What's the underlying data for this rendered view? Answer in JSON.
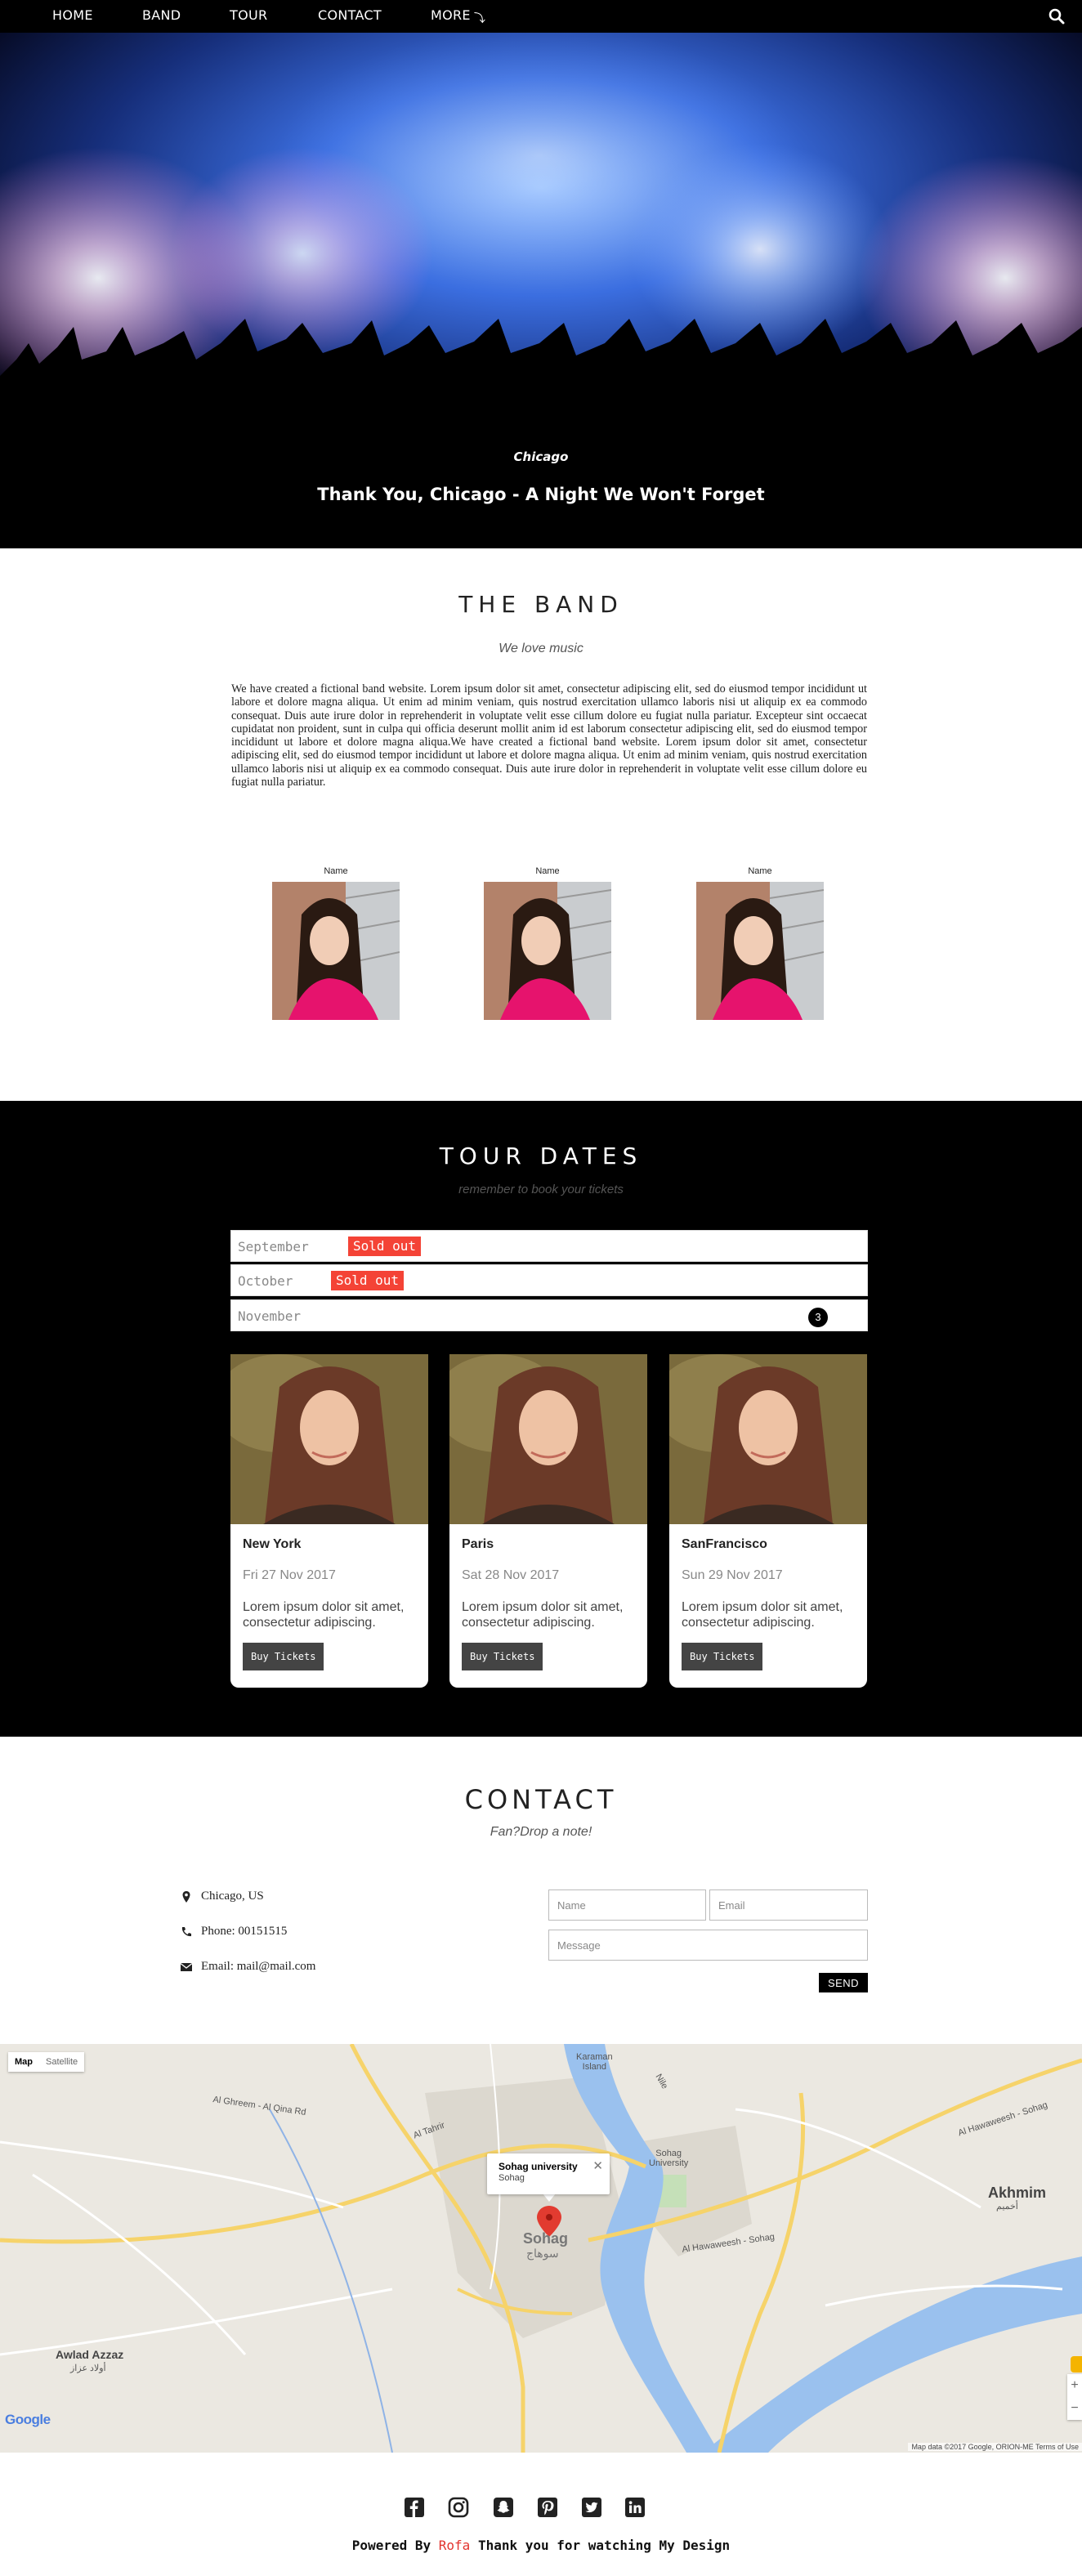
{
  "nav": {
    "items": [
      {
        "label": "HOME"
      },
      {
        "label": "BAND"
      },
      {
        "label": "TOUR"
      },
      {
        "label": "CONTACT"
      },
      {
        "label": "MORE"
      }
    ],
    "search_icon": "search-icon"
  },
  "hero": {
    "city": "Chicago",
    "caption": "Thank You, Chicago - A Night We Won't Forget"
  },
  "band": {
    "title": "THE BAND",
    "subtitle": "We love music",
    "text": "We have created a fictional band website. Lorem ipsum dolor sit amet, consectetur adipiscing elit, sed do eiusmod tempor incididunt ut labore et dolore magna aliqua. Ut enim ad minim veniam, quis nostrud exercitation ullamco laboris nisi ut aliquip ex ea commodo consequat. Duis aute irure dolor in reprehenderit in voluptate velit esse cillum dolore eu fugiat nulla pariatur. Excepteur sint occaecat cupidatat non proident, sunt in culpa qui officia deserunt mollit anim id est laborum consectetur adipiscing elit, sed do eiusmod tempor incididunt ut labore et dolore magna aliqua.We have created a fictional band website. Lorem ipsum dolor sit amet, consectetur adipiscing elit, sed do eiusmod tempor incididunt ut labore et dolore magna aliqua. Ut enim ad minim veniam, quis nostrud exercitation ullamco laboris nisi ut aliquip ex ea commodo consequat. Duis aute irure dolor in reprehenderit in voluptate velit esse cillum dolore eu fugiat nulla pariatur.",
    "members": [
      {
        "name": "Name"
      },
      {
        "name": "Name"
      },
      {
        "name": "Name"
      }
    ]
  },
  "tour": {
    "title": "TOUR DATES",
    "subtitle": "remember to book your tickets",
    "months": [
      {
        "name": "September",
        "badge": "Sold out"
      },
      {
        "name": "October",
        "badge": "Sold out"
      },
      {
        "name": "November",
        "count": "3"
      }
    ],
    "cities": [
      {
        "name": "New York",
        "date": "Fri 27 Nov 2017",
        "desc": "Lorem ipsum dolor sit amet, consectetur adipiscing.",
        "button": "Buy Tickets"
      },
      {
        "name": "Paris",
        "date": "Sat 28 Nov 2017",
        "desc": "Lorem ipsum dolor sit amet, consectetur adipiscing.",
        "button": "Buy Tickets"
      },
      {
        "name": "SanFrancisco",
        "date": "Sun 29 Nov 2017",
        "desc": "Lorem ipsum dolor sit amet, consectetur adipiscing.",
        "button": "Buy Tickets"
      }
    ]
  },
  "contact": {
    "title": "CONTACT",
    "subtitle": "Fan?Drop a note!",
    "location": "Chicago, US",
    "phone": "Phone: 00151515",
    "email": "Email: mail@mail.com",
    "name_placeholder": "Name",
    "email_placeholder": "Email",
    "message_placeholder": "Message",
    "send": "SEND"
  },
  "map": {
    "type_map": "Map",
    "type_satellite": "Satellite",
    "info_title": "Sohag university",
    "info_sub": "Sohag",
    "city_label": "Sohag",
    "city_label_ar": "سوهاج",
    "labels": {
      "karaman": "Karaman\nIsland",
      "akhmim": "Akhmim",
      "akhmim_ar": "أخميم",
      "awlad_azzaz": "Awlad Azzaz",
      "awlad_azzaz_ar": "أولاد عزاز",
      "sohag_univ": "Sohag\nUniversity",
      "al_hawaweesh": "Al Hawaweesh - Sohag",
      "al_hawaweesh2": "Al Hawaweesh - Sohag",
      "al_gheleem": "Al Ghreem - Al Qina Rd",
      "nile": "Nile",
      "al_tahrir": "Al Tahrir"
    },
    "google": "Google",
    "attribution": "Map data ©2017 Google, ORION-ME    Terms of Use",
    "zoom_in": "+",
    "zoom_out": "−"
  },
  "footer": {
    "social": [
      "facebook-icon",
      "instagram-icon",
      "snapchat-icon",
      "pinterest-icon",
      "twitter-icon",
      "linkedin-icon"
    ],
    "powered_prefix": "Powered By",
    "author": "Rofa",
    "powered_suffix": "Thank you for watching My Design"
  }
}
